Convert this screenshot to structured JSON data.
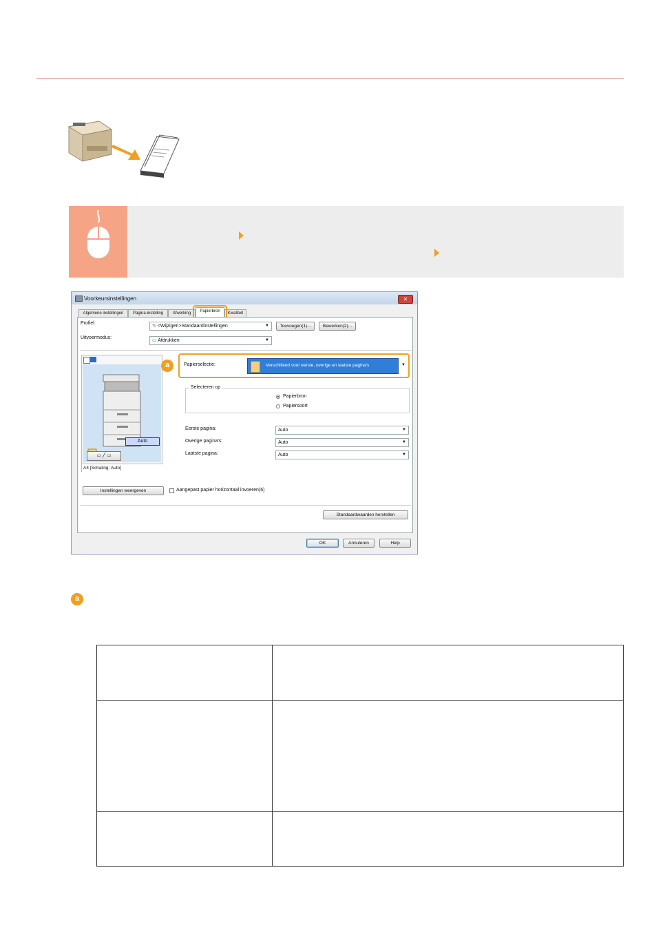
{
  "colors": {
    "accent": "#f0a020",
    "rule": "#c9785e",
    "banner_bg": "#ededed",
    "banner_icon_bg": "#f5a586"
  },
  "illustration": {
    "icon": "printer-output-icon"
  },
  "instruction_banner": {
    "icon": "mouse-icon"
  },
  "dialog": {
    "title": "Voorkeursinstellingen",
    "close_label": "✕",
    "tabs": [
      "Algemene instellingen",
      "Pagina-instelling",
      "Afwerking",
      "Papierbron",
      "Kwaliteit"
    ],
    "active_tab": "Papierbron",
    "profile_label": "Profiel:",
    "profile_value": "<Wijzigen>Standaardinstellingen",
    "add_button": "Toevoegen(1)...",
    "edit_button": "Bewerken(2)...",
    "output_label": "Uitvoermodus:",
    "output_value": "Afdrukken",
    "paper_selection_label": "Papierselectie:",
    "paper_selection_value": "Verschillend voor eerste, overige en laatste pagina's",
    "select_by_label": "Selecteren op",
    "radio_source": "Papierbron",
    "radio_type": "Papiersoort",
    "first_page_label": "Eerste pagina:",
    "first_page_value": "Auto",
    "other_pages_label": "Overige pagina's:",
    "other_pages_value": "Auto",
    "last_page_label": "Laatste pagina:",
    "last_page_value": "Auto",
    "preview_auto": "Auto",
    "preview_caption": "A4 [Schaling: Auto]",
    "view_settings_button": "Instellingen weergeven",
    "mirror_checkbox": "Aangepast papier horizontaal invoeren(6)",
    "restore_defaults_button": "Standaardwaarden herstellen",
    "ok_button": "OK",
    "cancel_button": "Annuleren",
    "help_button": "Help"
  },
  "callout": {
    "badge": "a"
  }
}
